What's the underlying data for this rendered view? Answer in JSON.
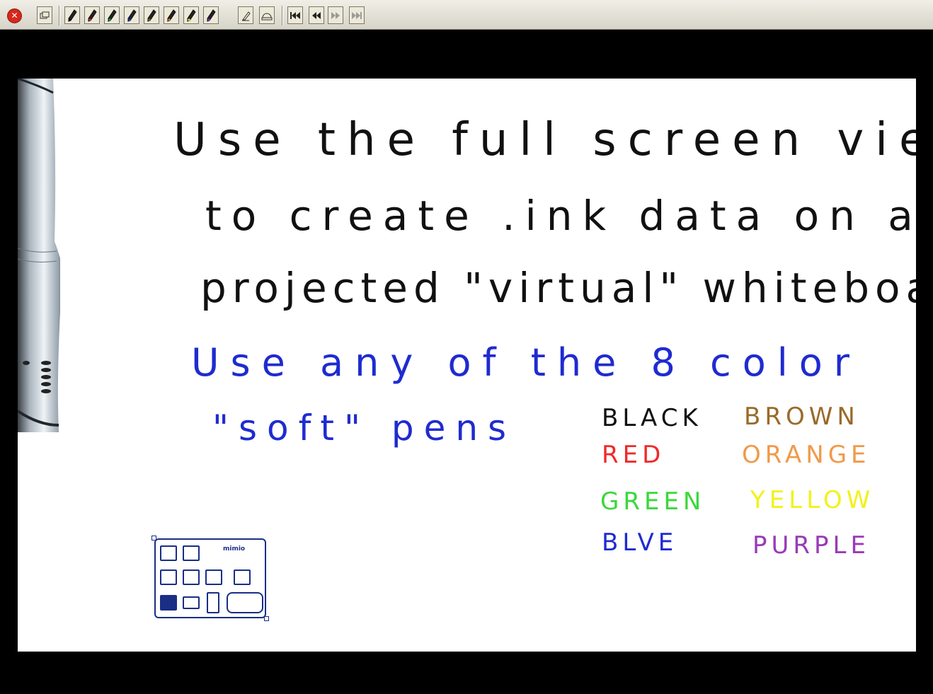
{
  "toolbar": {
    "buttons": [
      {
        "name": "close",
        "icon": "close-icon"
      },
      {
        "name": "window",
        "icon": "restore-window-icon"
      },
      {
        "name": "pen-black",
        "icon": "pen-icon",
        "color": "#111111"
      },
      {
        "name": "pen-red",
        "icon": "pen-icon",
        "color": "#e02020"
      },
      {
        "name": "pen-green",
        "icon": "pen-icon",
        "color": "#1a9a1a"
      },
      {
        "name": "pen-blue",
        "icon": "pen-icon",
        "color": "#1f2bd0"
      },
      {
        "name": "pen-brown",
        "icon": "pen-icon",
        "color": "#8a5a1e"
      },
      {
        "name": "pen-orange",
        "icon": "pen-icon",
        "color": "#e07a20"
      },
      {
        "name": "pen-yellow",
        "icon": "pen-icon",
        "color": "#e8d21a"
      },
      {
        "name": "pen-purple",
        "icon": "pen-icon",
        "color": "#8a2aa8"
      },
      {
        "name": "eraser",
        "icon": "eraser-icon"
      },
      {
        "name": "clear",
        "icon": "clear-board-icon"
      },
      {
        "name": "first-page",
        "icon": "first-page-icon"
      },
      {
        "name": "previous-page",
        "icon": "previous-page-icon"
      },
      {
        "name": "next-page",
        "icon": "next-page-icon"
      },
      {
        "name": "last-page",
        "icon": "last-page-icon"
      }
    ]
  },
  "board": {
    "lines": [
      "Use the full screen view",
      "to create .ink data on a",
      "projected \"virtual\" whiteboard.",
      "Use any of the 8 color",
      "\"soft\" pens"
    ],
    "colors": [
      {
        "label": "BLACK",
        "color": "#111111"
      },
      {
        "label": "BROWN",
        "color": "#9a6a2a"
      },
      {
        "label": "RED",
        "color": "#f02a2a"
      },
      {
        "label": "ORANGE",
        "color": "#f09a4a"
      },
      {
        "label": "GREEN",
        "color": "#3ad83a"
      },
      {
        "label": "YELLOW",
        "color": "#f2f21a"
      },
      {
        "label": "BLVE",
        "color": "#1f2bd0"
      },
      {
        "label": "PURPLE",
        "color": "#9a3ab8"
      }
    ]
  },
  "panel": {
    "brand": "mimio"
  }
}
